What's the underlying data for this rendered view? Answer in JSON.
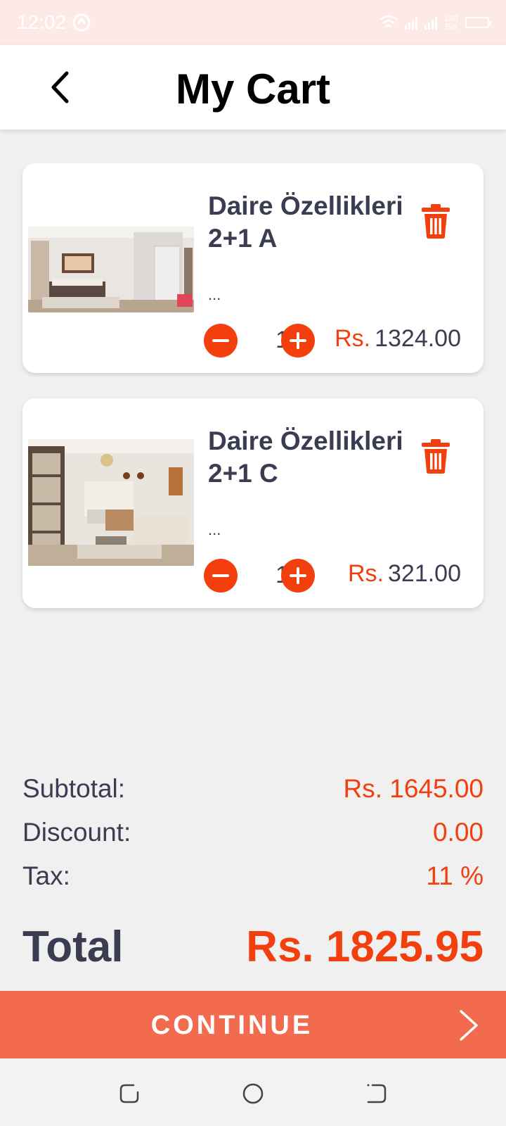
{
  "status": {
    "time": "12:02",
    "net_speed_value": "188",
    "net_speed_unit": "B/s"
  },
  "header": {
    "title": "My Cart"
  },
  "items": [
    {
      "title_line1": "Daire Özellikleri",
      "title_line2": "2+1 A",
      "desc": "...",
      "qty": "1",
      "currency": "Rs.",
      "price": "1324.00"
    },
    {
      "title_line1": "Daire Özellikleri",
      "title_line2": "2+1 C",
      "desc": "...",
      "qty": "1",
      "currency": "Rs.",
      "price": "321.00"
    }
  ],
  "summary": {
    "subtotal_label": "Subtotal:",
    "subtotal_value": "Rs. 1645.00",
    "discount_label": "Discount:",
    "discount_value": "0.00",
    "tax_label": "Tax:",
    "tax_value": "11 %",
    "total_label": "Total",
    "total_value": "Rs. 1825.95"
  },
  "continue_label": "CONTINUE",
  "colors": {
    "accent": "#f23f0d",
    "continue_bg": "#f26b4e",
    "text": "#3a3d52"
  },
  "icons": [
    "back-icon",
    "trash-icon",
    "minus-icon",
    "plus-icon",
    "chevron-right-icon",
    "recents-icon",
    "home-icon",
    "back-nav-icon"
  ]
}
